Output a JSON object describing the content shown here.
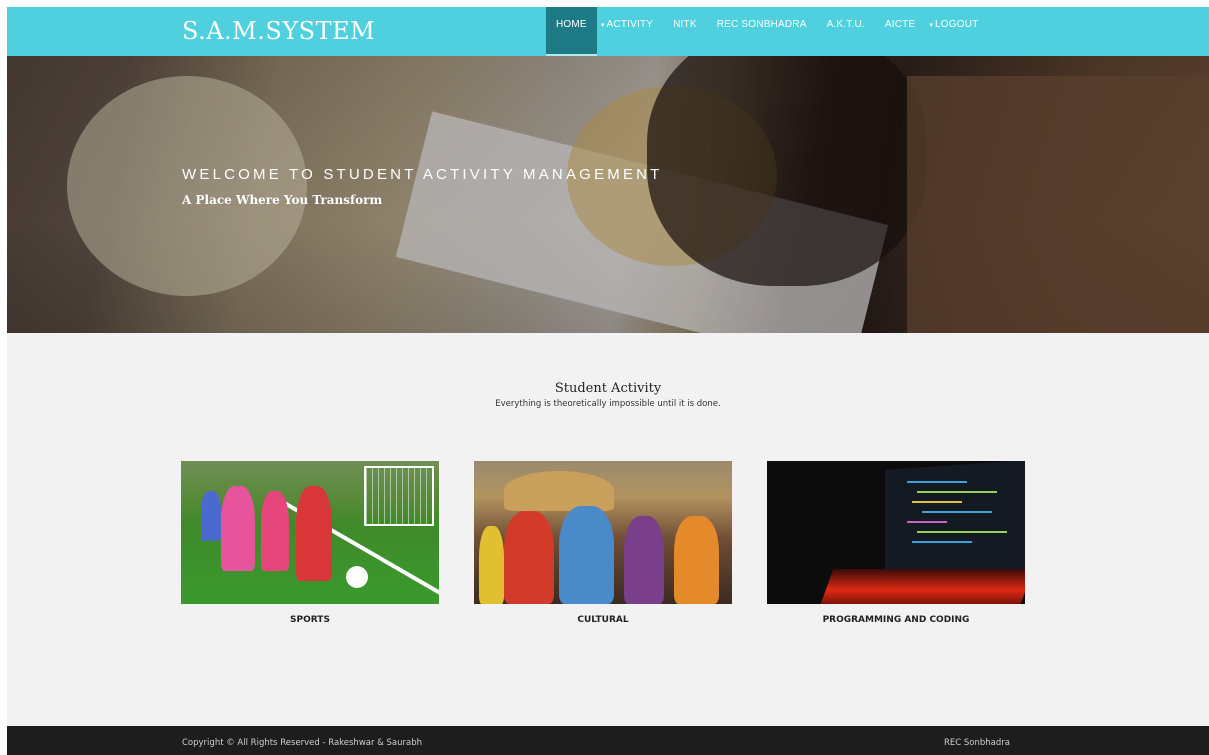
{
  "header": {
    "logo": "S.A.M.SYSTEM",
    "nav": [
      {
        "label": "HOME",
        "active": true,
        "dropdown": false
      },
      {
        "label": "ACTIVITY",
        "active": false,
        "dropdown": true
      },
      {
        "label": "NITK",
        "active": false,
        "dropdown": false
      },
      {
        "label": "REC SONBHADRA",
        "active": false,
        "dropdown": false
      },
      {
        "label": "A.K.T.U.",
        "active": false,
        "dropdown": false
      },
      {
        "label": "AICTE",
        "active": false,
        "dropdown": false
      },
      {
        "label": "LOGOUT",
        "active": false,
        "dropdown": true
      }
    ],
    "caret_glyph": "▾"
  },
  "hero": {
    "title": "WELCOME TO STUDENT ACTIVITY MANAGEMENT",
    "subtitle": "A Place Where You Transform"
  },
  "activity": {
    "title": "Student Activity",
    "tagline": "Everything is theoretically impossible until it is done.",
    "cards": [
      {
        "label": "SPORTS"
      },
      {
        "label": "CULTURAL"
      },
      {
        "label": "PROGRAMMING AND CODING"
      }
    ]
  },
  "footer": {
    "copyright": "Copyright © All Rights Reserved - Rakeshwar & Saurabh",
    "right": "REC Sonbhadra"
  },
  "colors": {
    "header_bg": "#4fd0df",
    "nav_active_bg": "#1e7b86",
    "page_bg": "#f2f2f2",
    "footer_bg": "#1d1d1d"
  }
}
